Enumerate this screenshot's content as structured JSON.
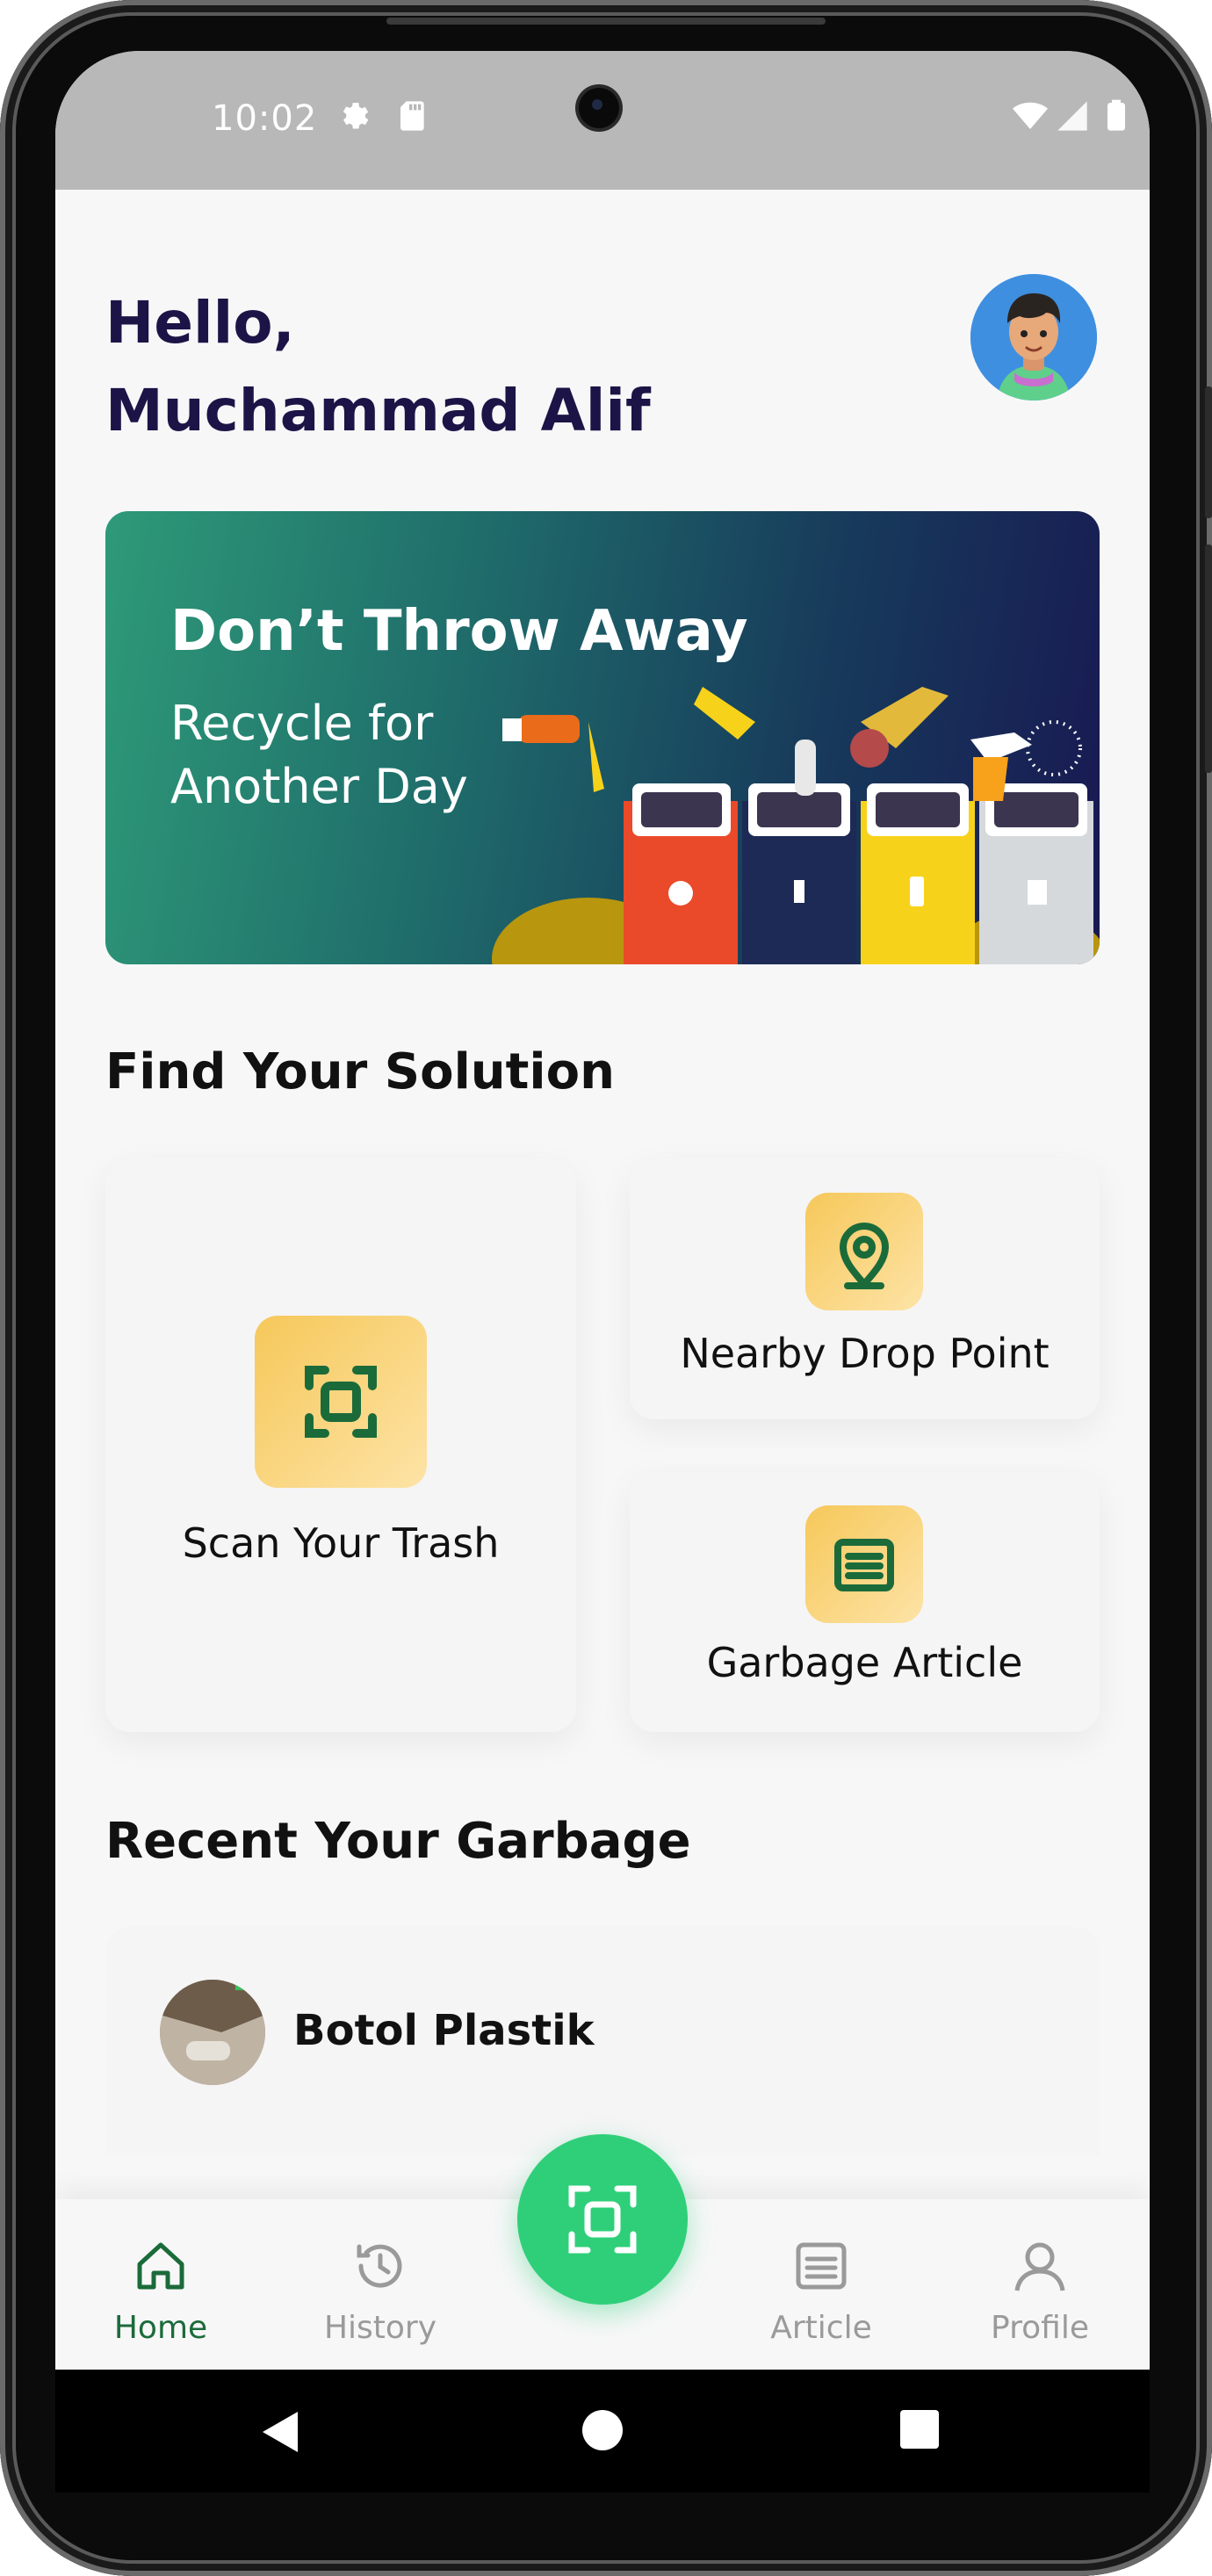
{
  "status_bar": {
    "time": "10:02"
  },
  "header": {
    "greeting_line1": "Hello,",
    "greeting_line2": "Muchammad Alif"
  },
  "banner": {
    "title": "Don’t Throw Away",
    "subtitle_line1": "Recycle for",
    "subtitle_line2": "Another Day"
  },
  "solutions": {
    "title": "Find Your Solution",
    "scan_label": "Scan Your Trash",
    "drop_point_label": "Nearby Drop Point",
    "article_label": "Garbage Article"
  },
  "recent": {
    "title": "Recent Your Garbage",
    "items": [
      {
        "name": "Botol Plastik"
      }
    ]
  },
  "bottom_nav": {
    "items": [
      {
        "label": "Home",
        "icon": "home-icon",
        "active": true
      },
      {
        "label": "History",
        "icon": "history-icon",
        "active": false
      },
      {
        "label": "Article",
        "icon": "article-icon",
        "active": false
      },
      {
        "label": "Profile",
        "icon": "profile-icon",
        "active": false
      }
    ]
  },
  "colors": {
    "primary_green": "#2fcf7a",
    "active_nav": "#1b6b3a",
    "inactive_nav": "#9a9a9a",
    "heading": "#1c1446",
    "icon_gold": "#f6c85a"
  }
}
